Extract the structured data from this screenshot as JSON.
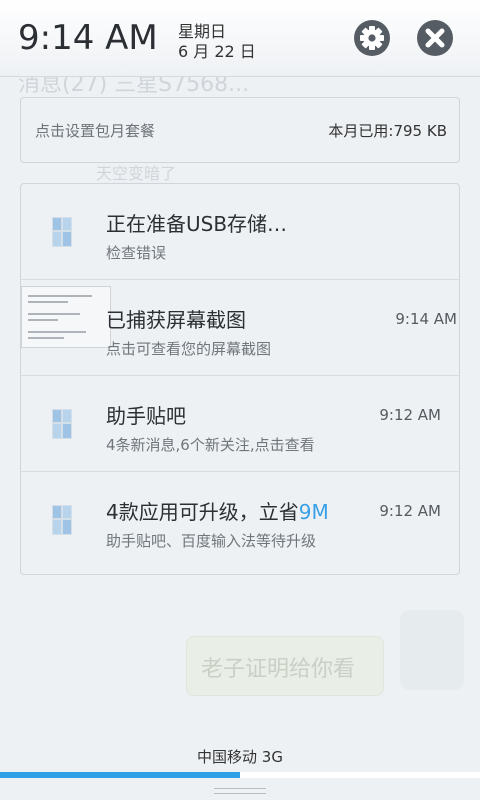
{
  "header": {
    "time": "9:14 AM",
    "weekday": "星期日",
    "date": "6 月 22 日",
    "settings_icon": "gear-icon",
    "close_icon": "close-icon"
  },
  "data_usage": {
    "hint": "点击设置包月套餐",
    "usage": "本月已用:795 KB"
  },
  "notifications": [
    {
      "title": "正在准备USB存储…",
      "subtitle": "检查错误",
      "time": ""
    },
    {
      "title": "已捕获屏幕截图",
      "subtitle": "点击可查看您的屏幕截图",
      "time": "9:14 AM"
    },
    {
      "title": "助手贴吧",
      "subtitle": "4条新消息,6个新关注,点击查看",
      "time": "9:12 AM"
    },
    {
      "title": "4款应用可升级，立省",
      "title_highlight": "9M",
      "subtitle": "助手贴吧、百度输入法等待升级",
      "time": "9:12 AM"
    }
  ],
  "background": {
    "header_text": "消息(27)  三星S7568...",
    "line_text": "天空变暗了",
    "bubble_text": "老子证明给你看"
  },
  "bottom": {
    "carrier": "中国移动 3G",
    "progress": 0.5
  },
  "colors": {
    "accent": "#2ea0e6",
    "highlight": "#39a0e8"
  }
}
